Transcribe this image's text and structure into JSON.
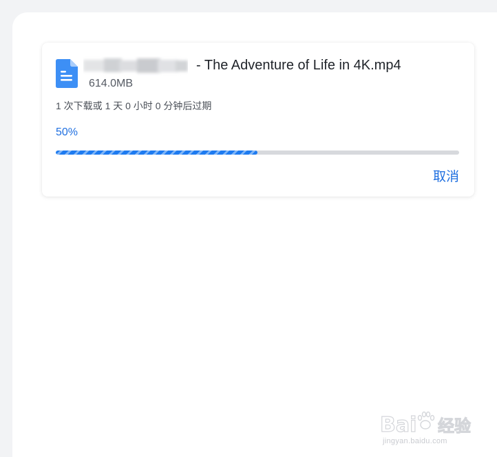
{
  "download": {
    "file_name": "- The Adventure of Life in 4K.mp4",
    "file_size": "614.0MB",
    "expire_text": "1 次下载或 1 天 0 小时 0 分钟后过期",
    "progress_label": "50%",
    "progress_fraction": 0.5,
    "cancel_label": "取消"
  },
  "watermark": {
    "logo_text": "Baidu 经验",
    "url_text": "jingyan.baidu.com"
  },
  "colors": {
    "accent": "#1f6fe0",
    "file_icon": "#3d8ff5",
    "progress_fill": "#1e7bf0",
    "progress_track": "#d7d9dd"
  },
  "icons": {
    "file": "document-icon"
  }
}
